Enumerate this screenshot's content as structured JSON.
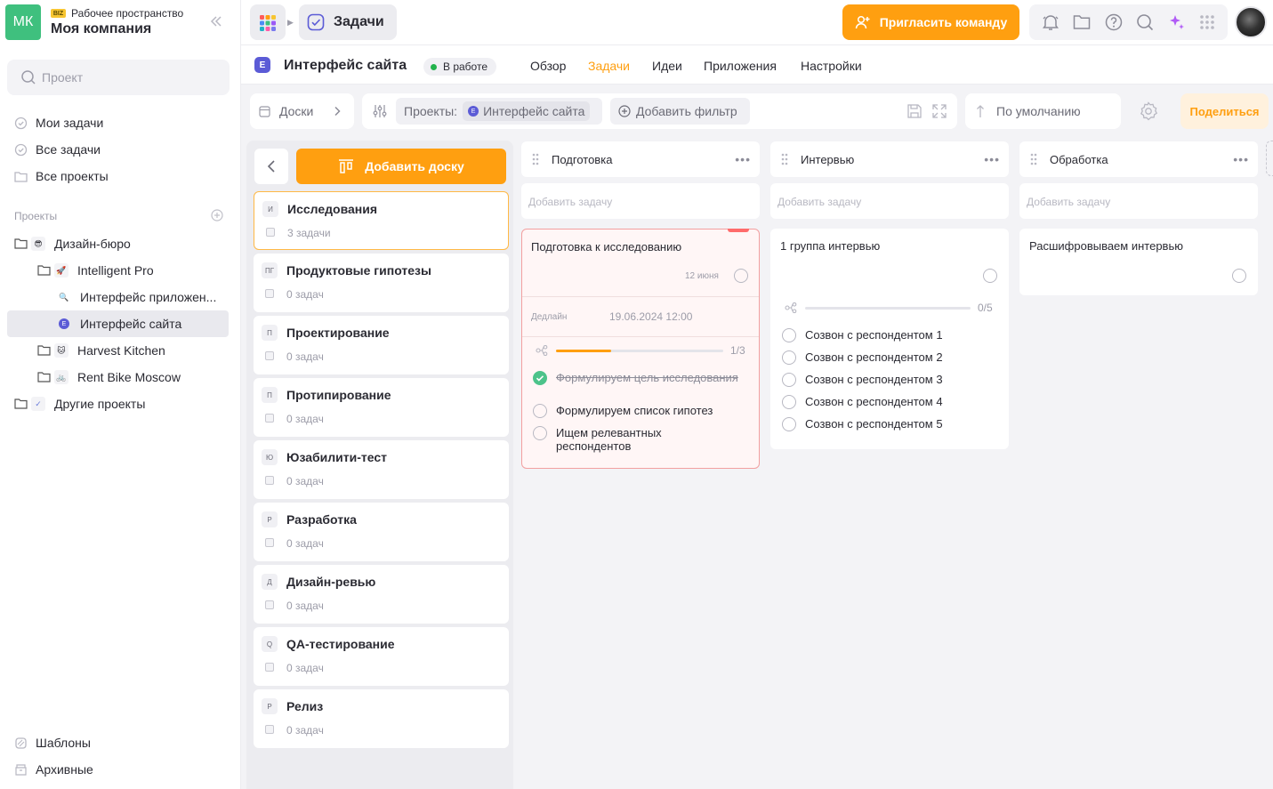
{
  "workspace": {
    "initials": "МК",
    "badge": "BIZ",
    "label": "Рабочее пространство",
    "name": "Моя компания"
  },
  "sidebar": {
    "search_placeholder": "Проект",
    "nav": [
      {
        "label": "Мои задачи",
        "icon": "check-circle-icon"
      },
      {
        "label": "Все задачи",
        "icon": "check-circle-icon"
      },
      {
        "label": "Все проекты",
        "icon": "folder-icon"
      }
    ],
    "section_title": "Проекты",
    "tree": [
      {
        "label": "Дизайн-бюро",
        "icon": "😎"
      },
      {
        "label": "Intelligent Pro",
        "icon": "🚀"
      },
      {
        "label": "Интерфейс приложен...",
        "icon": "🔍"
      },
      {
        "label": "Интерфейс сайта",
        "icon": "E"
      },
      {
        "label": "Harvest Kitchen",
        "icon": "🐱"
      },
      {
        "label": "Rent Bike Moscow",
        "icon": "🚲"
      },
      {
        "label": "Другие проекты",
        "icon": "✓"
      }
    ],
    "bottom": [
      {
        "label": "Шаблоны",
        "icon": "template-icon"
      },
      {
        "label": "Архивные",
        "icon": "archive-icon"
      }
    ]
  },
  "header": {
    "section": "Задачи",
    "invite": "Пригласить команду"
  },
  "project": {
    "title": "Интерфейс сайта",
    "icon_letter": "E",
    "status": "В работе",
    "tabs": [
      "Обзор",
      "Задачи",
      "Идеи",
      "Приложения",
      "Настройки"
    ],
    "active_tab": "Задачи"
  },
  "toolbar": {
    "boards_label": "Доски",
    "projects_label": "Проекты:",
    "project_chip": "Интерфейс сайта",
    "add_filter": "Добавить фильтр",
    "sort": "По умолчанию",
    "share": "Поделиться"
  },
  "boards": {
    "add_button": "Добавить доску",
    "items": [
      {
        "letter": "И",
        "name": "Исследования",
        "count": "3 задачи"
      },
      {
        "letter": "ПГ",
        "name": "Продуктовые гипотезы",
        "count": "0 задач"
      },
      {
        "letter": "П",
        "name": "Проектирование",
        "count": "0 задач"
      },
      {
        "letter": "П",
        "name": "Протипирование",
        "count": "0 задач"
      },
      {
        "letter": "Ю",
        "name": "Юзабилити-тест",
        "count": "0 задач"
      },
      {
        "letter": "Р",
        "name": "Разработка",
        "count": "0 задач"
      },
      {
        "letter": "Д",
        "name": "Дизайн-ревью",
        "count": "0 задач"
      },
      {
        "letter": "Q",
        "name": "QA-тестирование",
        "count": "0 задач"
      },
      {
        "letter": "Р",
        "name": "Релиз",
        "count": "0 задач"
      }
    ]
  },
  "columns": [
    {
      "title": "Подготовка",
      "add_task": "Добавить задачу",
      "card": {
        "title": "Подготовка к исследованию",
        "date": "12 июня",
        "deadline_label": "Дедлайн",
        "deadline_value": "19.06.2024 12:00",
        "progress_text": "1/3",
        "progress_fraction": 0.33,
        "subtasks": [
          {
            "label": "Формулируем цель исследования",
            "done": true
          },
          {
            "label": "Формулируем список гипотез",
            "done": false
          },
          {
            "label": "Ищем релевантных респондентов",
            "done": false
          }
        ]
      }
    },
    {
      "title": "Интервью",
      "add_task": "Добавить задачу",
      "card": {
        "title": "1 группа интервью",
        "progress_text": "0/5",
        "progress_fraction": 0,
        "subtasks": [
          {
            "label": "Созвон с респондентом 1",
            "done": false
          },
          {
            "label": "Созвон с респондентом 2",
            "done": false
          },
          {
            "label": "Созвон с респондентом 3",
            "done": false
          },
          {
            "label": "Созвон с респондентом 4",
            "done": false
          },
          {
            "label": "Созвон с респондентом 5",
            "done": false
          }
        ]
      }
    },
    {
      "title": "Обработка",
      "add_task": "Добавить задачу",
      "card": {
        "title": "Расшифровываем интервью"
      }
    }
  ],
  "colors": {
    "accent": "#ff9f10",
    "status_green": "#22b24c",
    "overdue_bg": "#fff6f6",
    "overdue_border": "#f2a0a0",
    "done_green": "#4cc38a"
  }
}
